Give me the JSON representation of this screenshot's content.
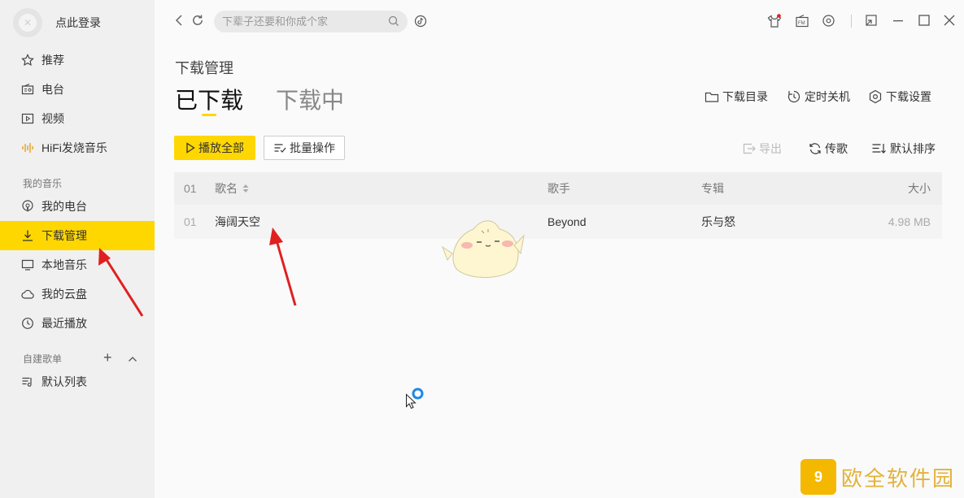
{
  "sidebar": {
    "login_text": "点此登录",
    "nav_top": [
      {
        "label": "推荐",
        "icon": "star-icon"
      },
      {
        "label": "电台",
        "icon": "radio-icon"
      },
      {
        "label": "视频",
        "icon": "video-icon"
      },
      {
        "label": "HiFi发烧音乐",
        "icon": "soundwave-icon"
      }
    ],
    "my_music_label": "我的音乐",
    "nav_my": [
      {
        "label": "我的电台",
        "icon": "podcast-icon"
      },
      {
        "label": "下载管理",
        "icon": "download-icon",
        "active": true
      },
      {
        "label": "本地音乐",
        "icon": "monitor-icon"
      },
      {
        "label": "我的云盘",
        "icon": "cloud-icon"
      },
      {
        "label": "最近播放",
        "icon": "clock-icon"
      }
    ],
    "playlist_label": "自建歌单",
    "playlists": [
      {
        "label": "默认列表",
        "icon": "playlist-icon"
      }
    ]
  },
  "topbar": {
    "search_placeholder": "下辈子还要和你成个家"
  },
  "main": {
    "page_title": "下载管理",
    "tabs": [
      {
        "label": "已下载",
        "active": true
      },
      {
        "label": "下载中",
        "active": false
      }
    ],
    "header_actions": [
      {
        "label": "下载目录",
        "icon": "folder-icon"
      },
      {
        "label": "定时关机",
        "icon": "timer-icon"
      },
      {
        "label": "下载设置",
        "icon": "settings-icon"
      }
    ],
    "play_all_label": "播放全部",
    "batch_label": "批量操作",
    "tools": [
      {
        "label": "导出",
        "icon": "export-icon",
        "disabled": true
      },
      {
        "label": "传歌",
        "icon": "sync-icon",
        "disabled": false
      },
      {
        "label": "默认排序",
        "icon": "sort-icon",
        "disabled": false
      }
    ],
    "table": {
      "headers": {
        "index": "01",
        "name": "歌名",
        "artist": "歌手",
        "album": "专辑",
        "size": "大小"
      },
      "rows": [
        {
          "index": "01",
          "name": "海阔天空",
          "artist": "Beyond",
          "album": "乐与怒",
          "size": "4.98 MB"
        }
      ]
    }
  },
  "watermark": {
    "text": "欧全软件园",
    "logo": "9"
  },
  "colors": {
    "accent": "#ffd700",
    "arrow": "#e02020"
  }
}
